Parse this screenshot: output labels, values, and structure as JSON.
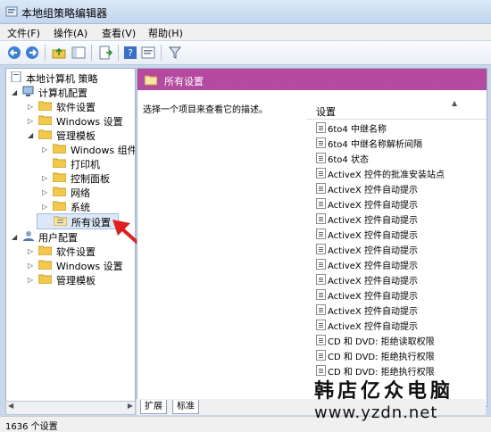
{
  "window": {
    "title": "本地组策略编辑器"
  },
  "menu": [
    {
      "label": "文件(F)"
    },
    {
      "label": "操作(A)"
    },
    {
      "label": "查看(V)"
    },
    {
      "label": "帮助(H)"
    }
  ],
  "tree": {
    "root": "本地计算机 策略",
    "computer_config": "计算机配置",
    "software_settings": "软件设置",
    "windows_settings": "Windows 设置",
    "admin_templates": "管理模板",
    "windows_components": "Windows 组件",
    "printers": "打印机",
    "control_panel": "控制面板",
    "network": "网络",
    "system": "系统",
    "all_settings": "所有设置",
    "user_config": "用户配置",
    "user_software_settings": "软件设置",
    "user_windows_settings": "Windows 设置",
    "user_admin_templates": "管理模板"
  },
  "details": {
    "header_title": "所有设置",
    "description": "选择一个项目来查看它的描述。",
    "column_header": "设置",
    "rows": [
      "6to4 中继名称",
      "6to4 中继名称解析间隔",
      "6to4 状态",
      "ActiveX 控件的批准安装站点",
      "ActiveX 控件自动提示",
      "ActiveX 控件自动提示",
      "ActiveX 控件自动提示",
      "ActiveX 控件自动提示",
      "ActiveX 控件自动提示",
      "ActiveX 控件自动提示",
      "ActiveX 控件自动提示",
      "ActiveX 控件自动提示",
      "ActiveX 控件自动提示",
      "ActiveX 控件自动提示",
      "CD 和 DVD: 拒绝读取权限",
      "CD 和 DVD: 拒绝执行权限",
      "CD 和 DVD: 拒绝执行权限"
    ]
  },
  "tabs": [
    {
      "label": "扩展"
    },
    {
      "label": "标准"
    }
  ],
  "status": {
    "text": "1636 个设置"
  },
  "watermark": {
    "line1": "韩店亿众电脑",
    "line2": "www.yzdn.net"
  },
  "colors": {
    "header_bg": "#b14aa0",
    "annotation_arrow": "#e02020",
    "folder": "#f2c94c"
  }
}
